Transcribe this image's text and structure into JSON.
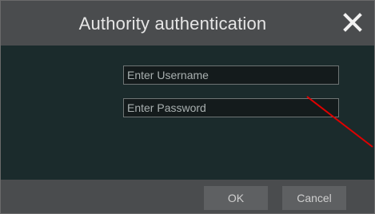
{
  "dialog": {
    "title": "Authority authentication",
    "close_icon": "close-icon"
  },
  "form": {
    "username": {
      "value": "",
      "placeholder": "Enter Username"
    },
    "password": {
      "value": "",
      "placeholder": "Enter Password"
    }
  },
  "buttons": {
    "ok_label": "OK",
    "cancel_label": "Cancel"
  },
  "colors": {
    "titlebar_bg": "#4a4c4e",
    "body_bg": "#1b2b2c",
    "field_bg": "#141b1c",
    "button_bg": "#5e6062",
    "annotation_arrow": "#e00000"
  },
  "annotations": {
    "arrow_icon": "red-pointer-line"
  }
}
